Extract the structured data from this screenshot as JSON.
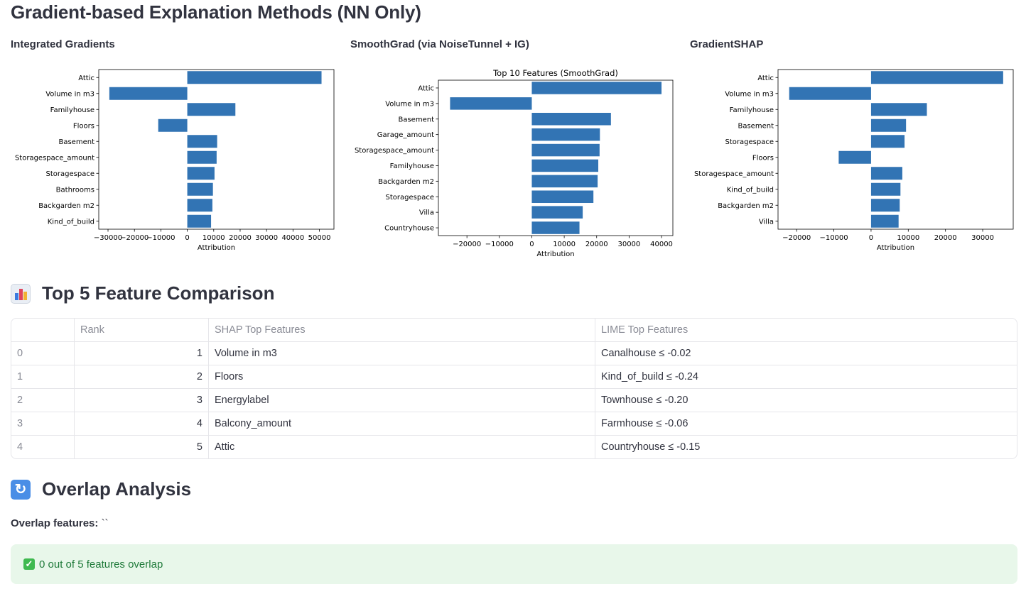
{
  "page_title": "Gradient-based Explanation Methods (NN Only)",
  "charts": [
    {
      "heading": "Integrated Gradients"
    },
    {
      "heading": "SmoothGrad (via NoiseTunnel + IG)"
    },
    {
      "heading": "GradientSHAP"
    }
  ],
  "chart_data": [
    {
      "type": "bar",
      "orientation": "horizontal",
      "title": "",
      "xlabel": "Attribution",
      "ylabel": "",
      "categories": [
        "Attic",
        "Volume in m3",
        "Familyhouse",
        "Floors",
        "Basement",
        "Storagespace_amount",
        "Storagespace",
        "Bathrooms",
        "Backgarden m2",
        "Kind_of_build"
      ],
      "values": [
        50800,
        -29500,
        18200,
        -11000,
        11300,
        11100,
        10300,
        9700,
        9500,
        9000
      ],
      "xlim": [
        -33500,
        55500
      ],
      "xticks": [
        -30000,
        -20000,
        -10000,
        0,
        10000,
        20000,
        30000,
        40000,
        50000
      ],
      "xtick_labels": [
        "−30000",
        "−20000",
        "−10000",
        "0",
        "10000",
        "20000",
        "30000",
        "40000",
        "50000"
      ],
      "grid": false,
      "color": "#3274b4"
    },
    {
      "type": "bar",
      "orientation": "horizontal",
      "title": "Top 10 Features (SmoothGrad)",
      "xlabel": "Attribution",
      "ylabel": "",
      "categories": [
        "Attic",
        "Volume in m3",
        "Basement",
        "Garage_amount",
        "Storagespace_amount",
        "Familyhouse",
        "Backgarden m2",
        "Storagespace",
        "Villa",
        "Countryhouse"
      ],
      "values": [
        40000,
        -25200,
        24400,
        21000,
        20900,
        20500,
        20300,
        19000,
        15700,
        14700
      ],
      "xlim": [
        -28800,
        43500
      ],
      "xticks": [
        -20000,
        -10000,
        0,
        10000,
        20000,
        30000,
        40000
      ],
      "xtick_labels": [
        "−20000",
        "−10000",
        "0",
        "10000",
        "20000",
        "30000",
        "40000"
      ],
      "grid": false,
      "color": "#3274b4"
    },
    {
      "type": "bar",
      "orientation": "horizontal",
      "title": "",
      "xlabel": "Attribution",
      "ylabel": "",
      "categories": [
        "Attic",
        "Volume in m3",
        "Familyhouse",
        "Basement",
        "Storagespace",
        "Floors",
        "Storagespace_amount",
        "Kind_of_build",
        "Backgarden m2",
        "Villa"
      ],
      "values": [
        35500,
        -22000,
        15000,
        9400,
        9000,
        -8700,
        8400,
        7900,
        7700,
        7400
      ],
      "xlim": [
        -25000,
        38200
      ],
      "xticks": [
        -20000,
        -10000,
        0,
        10000,
        20000,
        30000
      ],
      "xtick_labels": [
        "−20000",
        "−10000",
        "0",
        "10000",
        "20000",
        "30000"
      ],
      "grid": false,
      "color": "#3274b4"
    }
  ],
  "comparison": {
    "title": "Top 5 Feature Comparison",
    "columns": [
      "",
      "Rank",
      "SHAP Top Features",
      "LIME Top Features"
    ],
    "rows": [
      [
        "0",
        "1",
        "Volume in m3",
        "Canalhouse ≤ -0.02"
      ],
      [
        "1",
        "2",
        "Floors",
        "Kind_of_build ≤ -0.24"
      ],
      [
        "2",
        "3",
        "Energylabel",
        "Townhouse ≤ -0.20"
      ],
      [
        "3",
        "4",
        "Balcony_amount",
        "Farmhouse ≤ -0.06"
      ],
      [
        "4",
        "5",
        "Attic",
        "Countryhouse ≤ -0.15"
      ]
    ]
  },
  "overlap": {
    "title": "Overlap Analysis",
    "label": "Overlap features:",
    "value": "``",
    "message": "0 out of 5 features overlap"
  },
  "icons": {
    "comparison_icon": "bar-chart-emoji-icon",
    "overlap_icon": "repeat-arrows-emoji-icon",
    "success_icon": "check-box-icon"
  }
}
